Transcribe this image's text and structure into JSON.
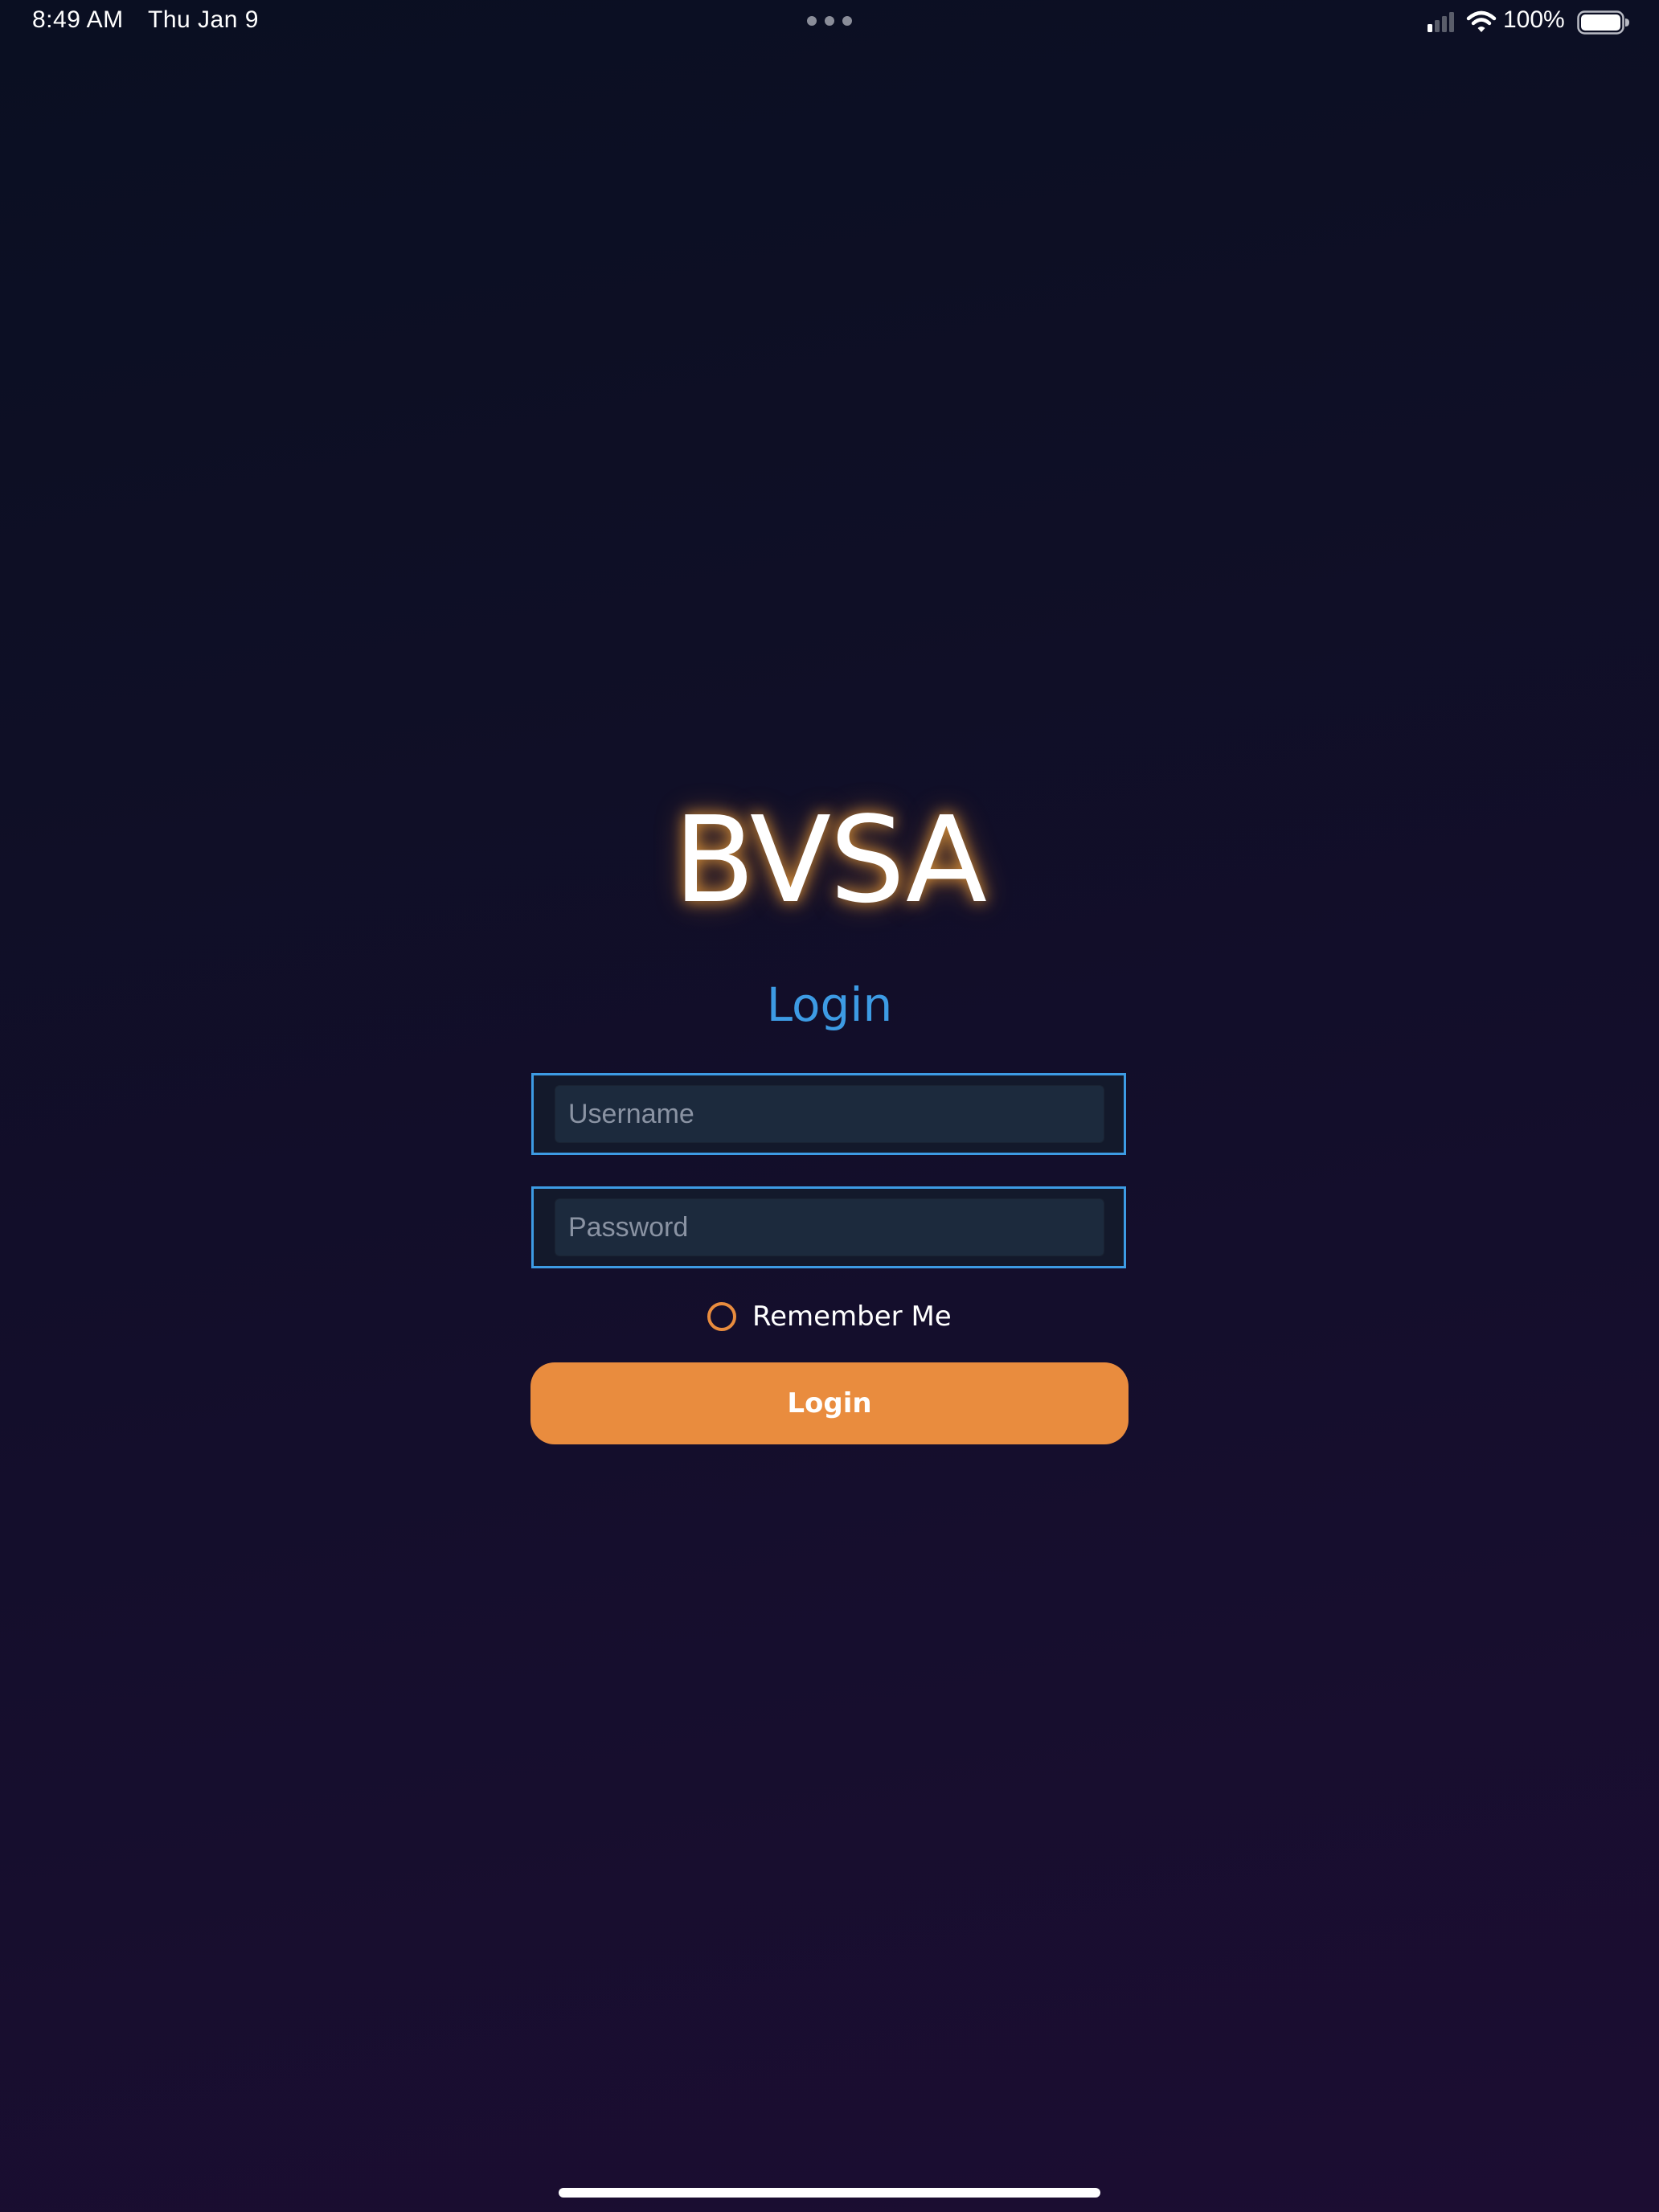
{
  "status_bar": {
    "time": "8:49 AM",
    "date": "Thu Jan 9",
    "battery_percent": "100%",
    "signal_bars_active": 1,
    "signal_bars_total": 4,
    "battery_level": 1.0,
    "icons": [
      "signal-icon",
      "wifi-icon",
      "battery-icon"
    ]
  },
  "login": {
    "app_title": "BVSA",
    "heading": "Login",
    "username_placeholder": "Username",
    "username_value": "",
    "password_placeholder": "Password",
    "password_value": "",
    "remember_label": "Remember Me",
    "remember_checked": false,
    "button_label": "Login"
  },
  "colors": {
    "accent_blue": "#3d9be4",
    "accent_orange": "#e98c3e",
    "background_top": "#0a0f22",
    "background_bottom": "#1c0d32",
    "input_fill": "#1c2a3d",
    "title_glow": "#ffaa3c"
  }
}
